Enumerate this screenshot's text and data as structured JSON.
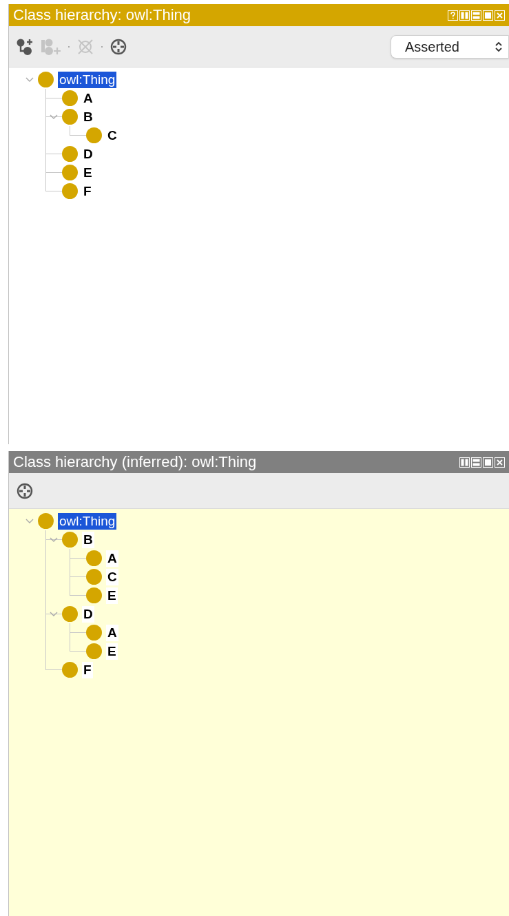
{
  "panels": [
    {
      "title": "Class hierarchy: owl:Thing",
      "active": true,
      "help_button": true,
      "kind": "asserted",
      "toolbar": [
        {
          "kind": "add_subclass",
          "disabled": false
        },
        {
          "kind": "add_sibling",
          "disabled": true
        },
        {
          "kind": "separator"
        },
        {
          "kind": "delete",
          "disabled": true
        },
        {
          "kind": "separator"
        },
        {
          "kind": "target",
          "disabled": false
        }
      ],
      "dropdown": {
        "value": "Asserted"
      },
      "tree": [
        {
          "label": "owl:Thing",
          "selected": true,
          "expanded": true,
          "children": [
            {
              "label": "A",
              "selected": false
            },
            {
              "label": "B",
              "selected": false,
              "expanded": true,
              "children": [
                {
                  "label": "C",
                  "selected": false
                }
              ]
            },
            {
              "label": "D",
              "selected": false
            },
            {
              "label": "E",
              "selected": false
            },
            {
              "label": "F",
              "selected": false
            }
          ]
        }
      ]
    },
    {
      "title": "Class hierarchy (inferred): owl:Thing",
      "active": false,
      "help_button": false,
      "kind": "inferred",
      "toolbar": [
        {
          "kind": "target",
          "disabled": false
        }
      ],
      "tree": [
        {
          "label": "owl:Thing",
          "selected": true,
          "expanded": true,
          "children": [
            {
              "label": "B",
              "selected": false,
              "expanded": true,
              "children": [
                {
                  "label": "A",
                  "selected": false
                },
                {
                  "label": "C",
                  "selected": false
                },
                {
                  "label": "E",
                  "selected": false
                }
              ]
            },
            {
              "label": "D",
              "selected": false,
              "expanded": true,
              "children": [
                {
                  "label": "A",
                  "selected": false
                },
                {
                  "label": "E",
                  "selected": false
                }
              ]
            },
            {
              "label": "F",
              "selected": false
            }
          ]
        }
      ]
    }
  ]
}
